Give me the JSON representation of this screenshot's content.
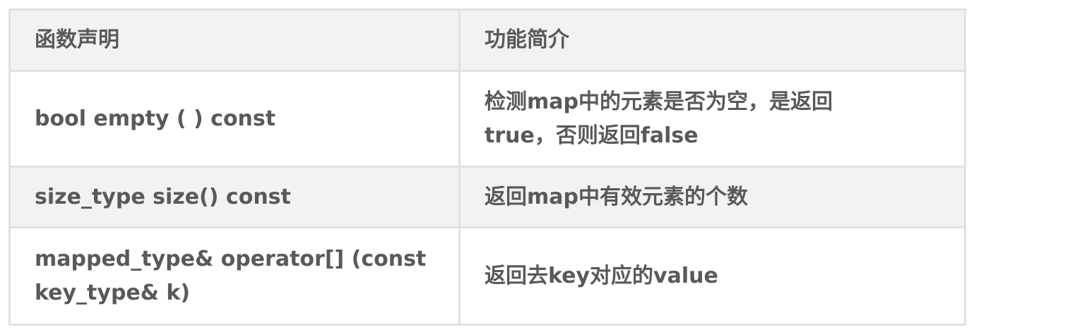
{
  "table": {
    "headers": [
      "函数声明",
      "功能简介"
    ],
    "rows": [
      {
        "declaration": "bool empty ( ) const",
        "description": "检测map中的元素是否为空，是返回true，否则返回false"
      },
      {
        "declaration": "size_type size() const",
        "description": "返回map中有效元素的个数"
      },
      {
        "declaration": "mapped_type& operator[] (const key_type& k)",
        "description": "返回去key对应的value"
      }
    ]
  }
}
